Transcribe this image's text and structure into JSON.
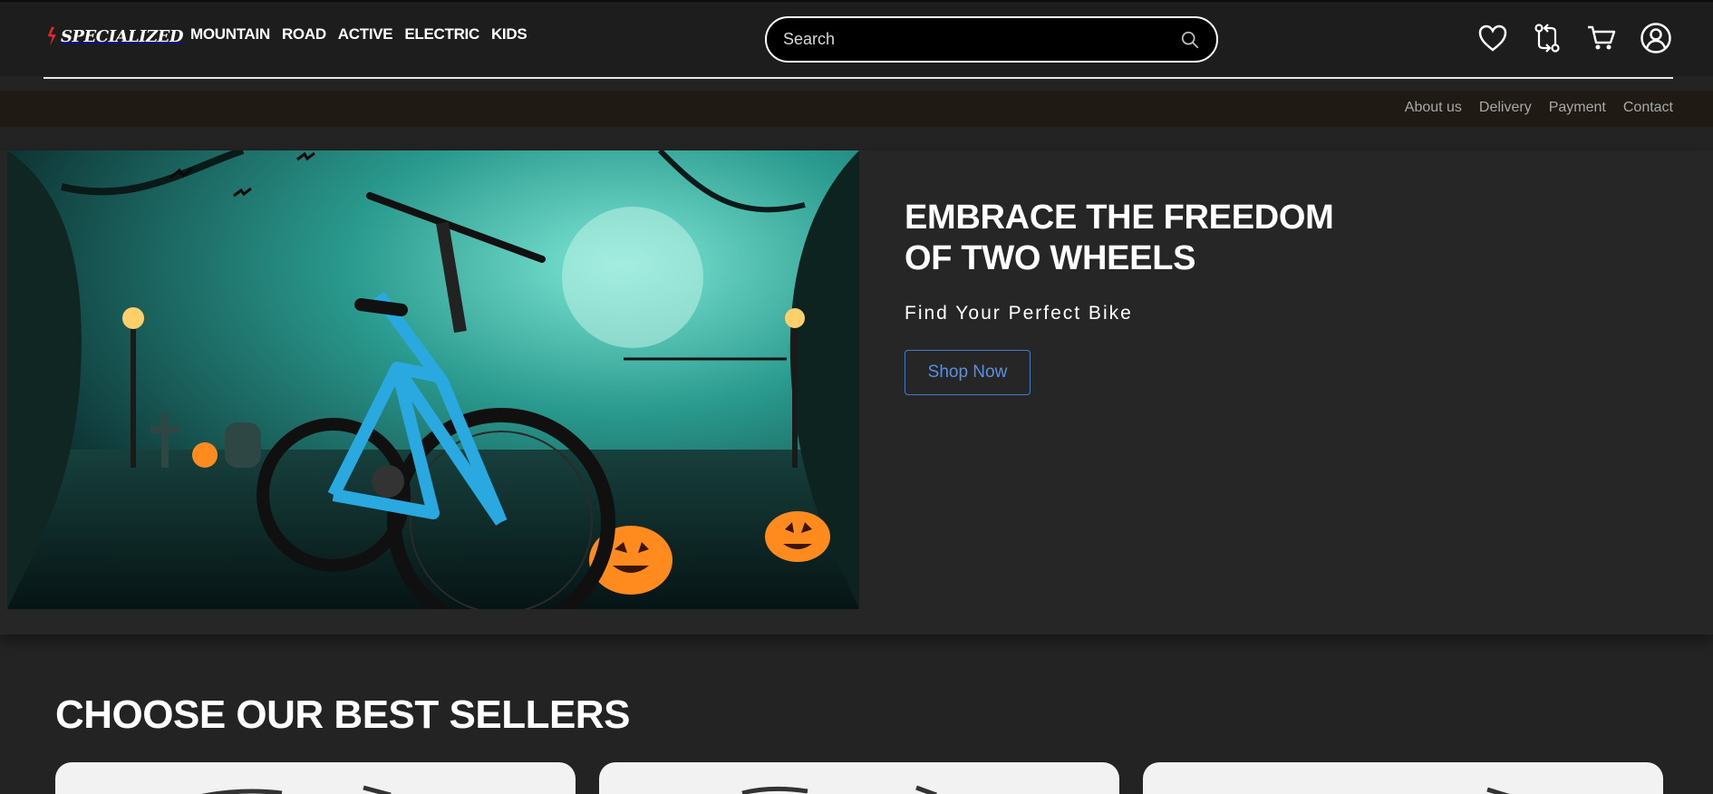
{
  "header": {
    "logo_text": "SPECIALIZED",
    "nav": [
      "MOUNTAIN",
      "ROAD",
      "ACTIVE",
      "ELECTRIC",
      "KIDS"
    ],
    "search": {
      "placeholder": "Search",
      "value": ""
    },
    "icons": [
      "heart-icon",
      "compare-icon",
      "cart-icon",
      "account-icon"
    ]
  },
  "subnav": [
    "About us",
    "Delivery",
    "Payment",
    "Contact"
  ],
  "hero": {
    "title_line1": "EMBRACE THE FREEDOM",
    "title_line2": "OF TWO WHEELS",
    "subtitle": "Find Your Perfect Bike",
    "button": "Shop Now"
  },
  "best_sellers": {
    "title": "CHOOSE OUR BEST SELLERS",
    "card_count": 3
  },
  "colors": {
    "background": "#232323",
    "topbar": "#1d1d1d",
    "subbar": "#1f1a14",
    "brand_red": "#e3262b",
    "button_blue": "#5b8fe0"
  }
}
